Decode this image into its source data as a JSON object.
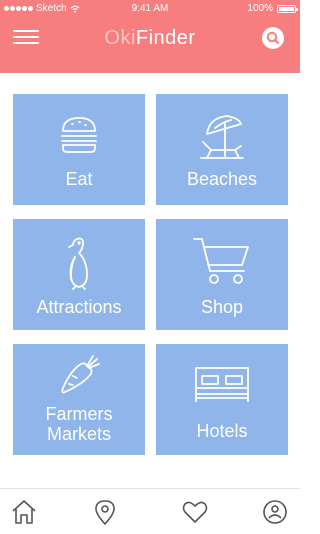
{
  "status_bar": {
    "carrier": "Sketch",
    "time": "9:41 AM",
    "battery": "100%"
  },
  "header": {
    "title_part1": "Oki",
    "title_part2": "Finder",
    "menu_icon": "hamburger-menu-icon",
    "search_icon": "search-icon"
  },
  "categories": [
    {
      "label": "Eat",
      "icon": "burger-icon"
    },
    {
      "label": "Beaches",
      "icon": "beach-umbrella-icon"
    },
    {
      "label": "Attractions",
      "icon": "penguin-icon"
    },
    {
      "label": "Shop",
      "icon": "shopping-cart-icon"
    },
    {
      "label_line1": "Farmers",
      "label_line2": "Markets",
      "icon": "carrot-icon"
    },
    {
      "label": "Hotels",
      "icon": "bed-icon"
    }
  ],
  "tabbar": {
    "items": [
      "home-icon",
      "location-pin-icon",
      "heart-icon",
      "profile-icon"
    ]
  },
  "colors": {
    "header": "#f77e7e",
    "tile": "#8fb5ea",
    "tab_icon": "#555555"
  }
}
